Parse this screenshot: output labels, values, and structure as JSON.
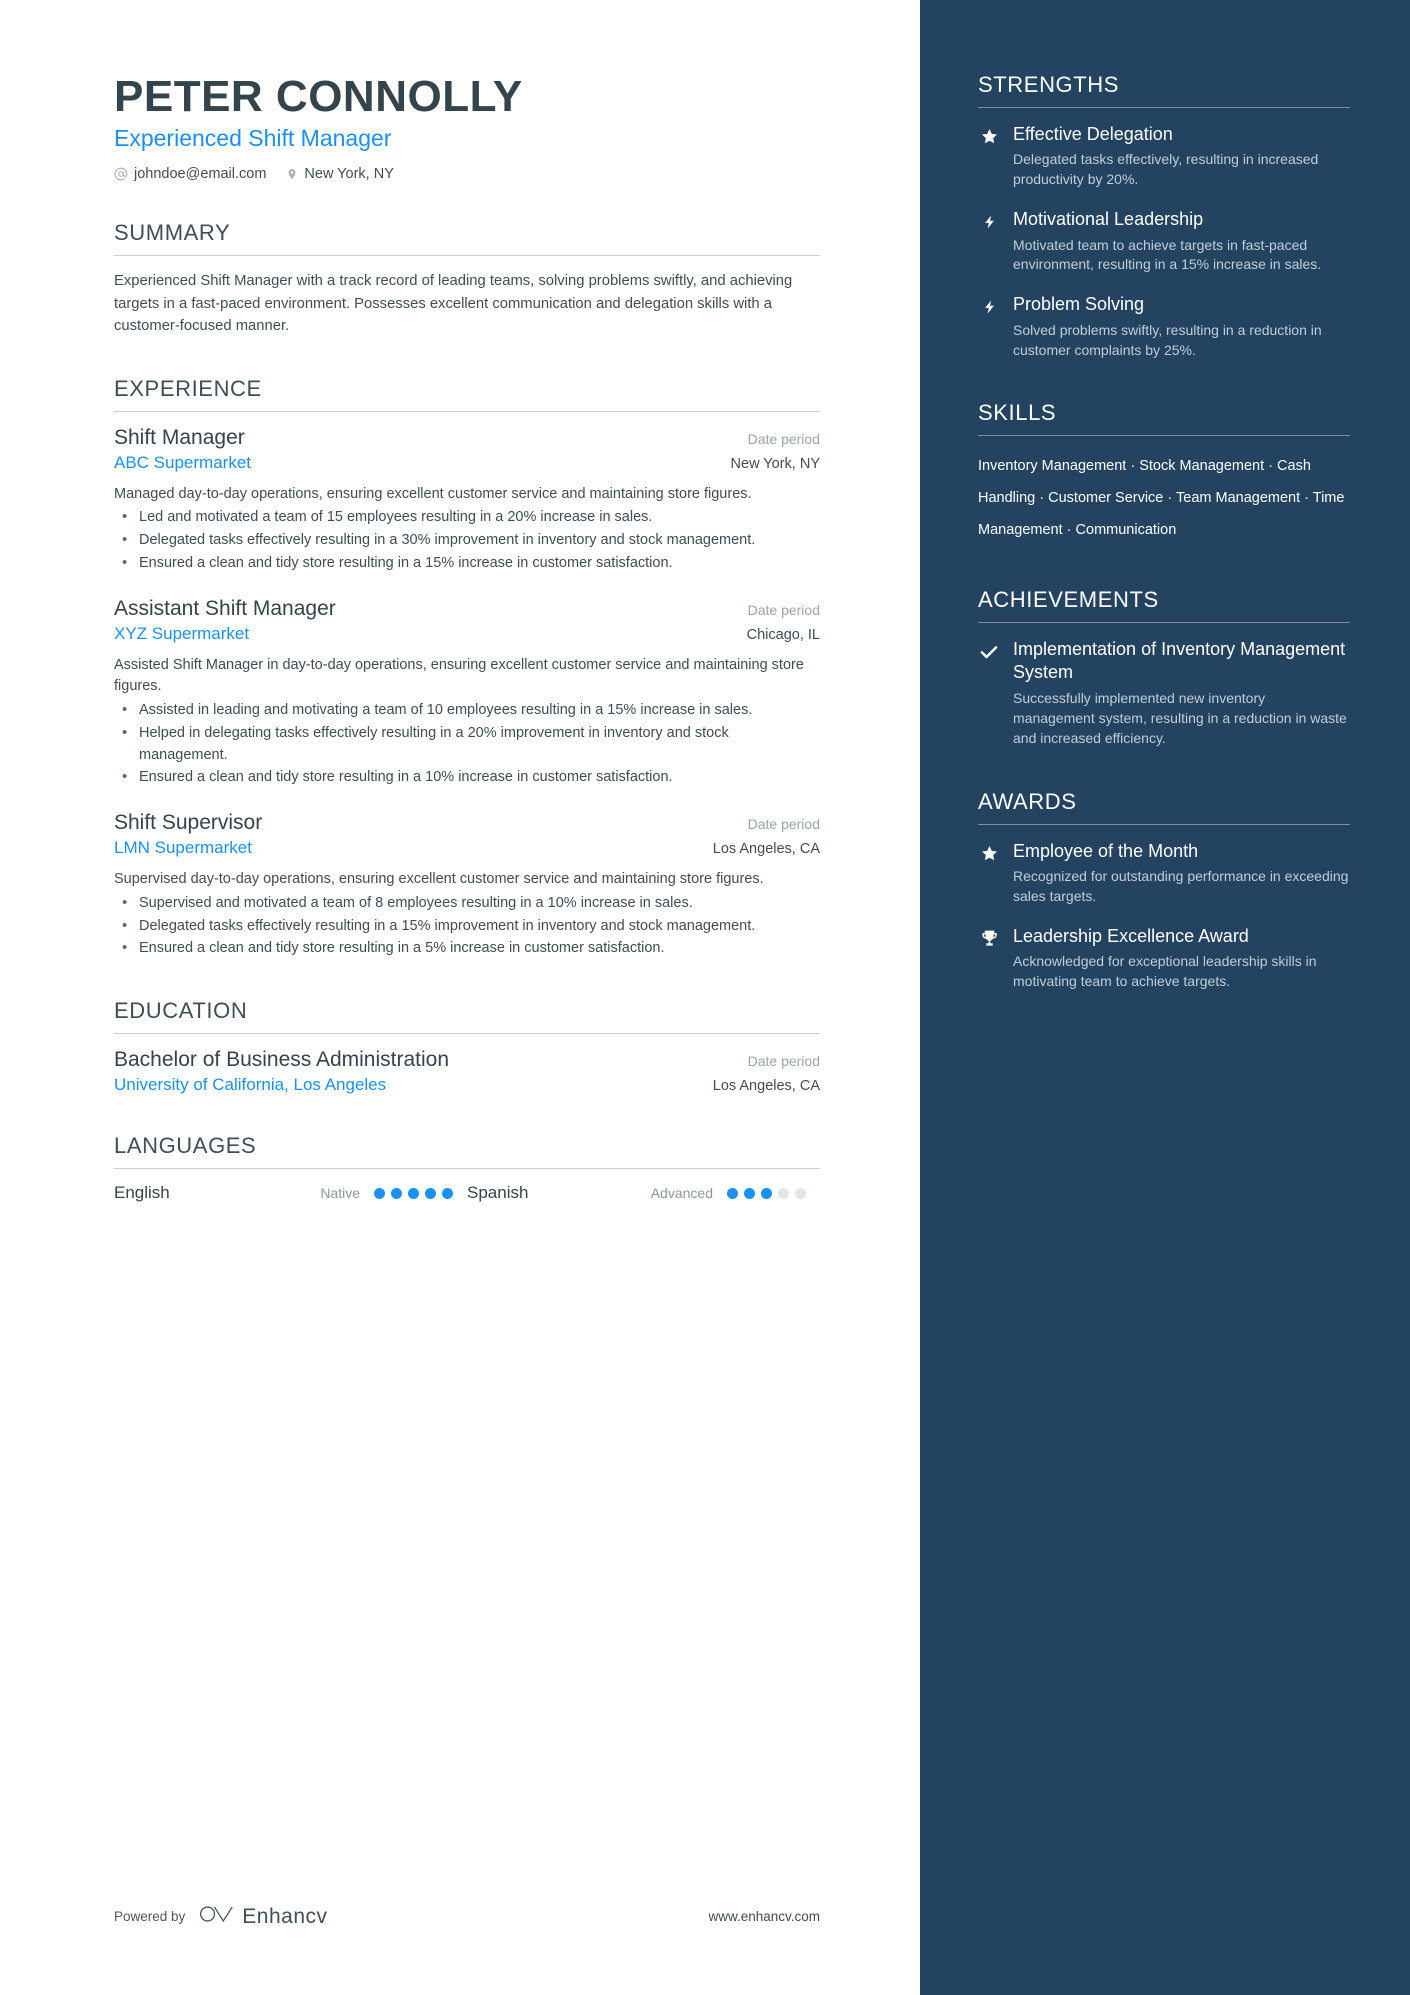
{
  "colors": {
    "accent_blue": "#1a91f0",
    "sidebar_bg": "#234361",
    "heading": "#3f4e57",
    "body_text": "#3e4d56",
    "muted": "#9aa4ac"
  },
  "header": {
    "name": "PETER CONNOLLY",
    "headline": "Experienced Shift Manager",
    "email": "johndoe@email.com",
    "location": "New York, NY",
    "email_icon": "at-sign-icon",
    "location_icon": "map-pin-icon"
  },
  "summary": {
    "title": "SUMMARY",
    "text": "Experienced Shift Manager with a track record of leading teams, solving problems swiftly, and achieving targets in a fast-paced environment. Possesses excellent communication and delegation skills with a customer-focused manner."
  },
  "experience": {
    "title": "EXPERIENCE",
    "entries": [
      {
        "role": "Shift Manager",
        "date": "Date period",
        "company": "ABC Supermarket",
        "location": "New York, NY",
        "description": "Managed day-to-day operations, ensuring excellent customer service and maintaining store figures.",
        "bullets": [
          "Led and motivated a team of 15 employees resulting in a 20% increase in sales.",
          "Delegated tasks effectively resulting in a 30% improvement in inventory and stock management.",
          "Ensured a clean and tidy store resulting in a 15% increase in customer satisfaction."
        ]
      },
      {
        "role": "Assistant Shift Manager",
        "date": "Date period",
        "company": "XYZ Supermarket",
        "location": "Chicago, IL",
        "description": "Assisted Shift Manager in day-to-day operations, ensuring excellent customer service and maintaining store figures.",
        "bullets": [
          "Assisted in leading and motivating a team of 10 employees resulting in a 15% increase in sales.",
          "Helped in delegating tasks effectively resulting in a 20% improvement in inventory and stock management.",
          "Ensured a clean and tidy store resulting in a 10% increase in customer satisfaction."
        ]
      },
      {
        "role": "Shift Supervisor",
        "date": "Date period",
        "company": "LMN Supermarket",
        "location": "Los Angeles, CA",
        "description": "Supervised day-to-day operations, ensuring excellent customer service and maintaining store figures.",
        "bullets": [
          "Supervised and motivated a team of 8 employees resulting in a 10% increase in sales.",
          "Delegated tasks effectively resulting in a 15% improvement in inventory and stock management.",
          "Ensured a clean and tidy store resulting in a 5% increase in customer satisfaction."
        ]
      }
    ]
  },
  "education": {
    "title": "EDUCATION",
    "entries": [
      {
        "degree": "Bachelor of Business Administration",
        "date": "Date period",
        "school": "University of California, Los Angeles",
        "location": "Los Angeles, CA"
      }
    ]
  },
  "languages": {
    "title": "LANGUAGES",
    "items": [
      {
        "name": "English",
        "level": "Native",
        "filled": 5,
        "total": 5
      },
      {
        "name": "Spanish",
        "level": "Advanced",
        "filled": 3,
        "total": 5
      }
    ]
  },
  "footer": {
    "powered_by": "Powered by",
    "brand": "Enhancv",
    "brand_icon": "enhancv-logo-icon",
    "website": "www.enhancv.com"
  },
  "sidebar": {
    "strengths": {
      "title": "STRENGTHS",
      "items": [
        {
          "icon": "star-icon",
          "title": "Effective Delegation",
          "desc": "Delegated tasks effectively, resulting in increased productivity by 20%."
        },
        {
          "icon": "bolt-icon",
          "title": "Motivational Leadership",
          "desc": "Motivated team to achieve targets in fast-paced environment, resulting in a 15% increase in sales."
        },
        {
          "icon": "bolt-icon",
          "title": "Problem Solving",
          "desc": "Solved problems swiftly, resulting in a reduction in customer complaints by 25%."
        }
      ]
    },
    "skills": {
      "title": "SKILLS",
      "items": [
        "Inventory Management",
        "Stock Management",
        "Cash Handling",
        "Customer Service",
        "Team Management",
        "Time Management",
        "Communication"
      ],
      "separator": "·"
    },
    "achievements": {
      "title": "ACHIEVEMENTS",
      "items": [
        {
          "icon": "check-icon",
          "title": "Implementation of Inventory Management System",
          "desc": "Successfully implemented new inventory management system, resulting in a reduction in waste and increased efficiency."
        }
      ]
    },
    "awards": {
      "title": "AWARDS",
      "items": [
        {
          "icon": "star-icon",
          "title": "Employee of the Month",
          "desc": "Recognized for outstanding performance in exceeding sales targets."
        },
        {
          "icon": "trophy-icon",
          "title": "Leadership Excellence Award",
          "desc": "Acknowledged for exceptional leadership skills in motivating team to achieve targets."
        }
      ]
    }
  }
}
